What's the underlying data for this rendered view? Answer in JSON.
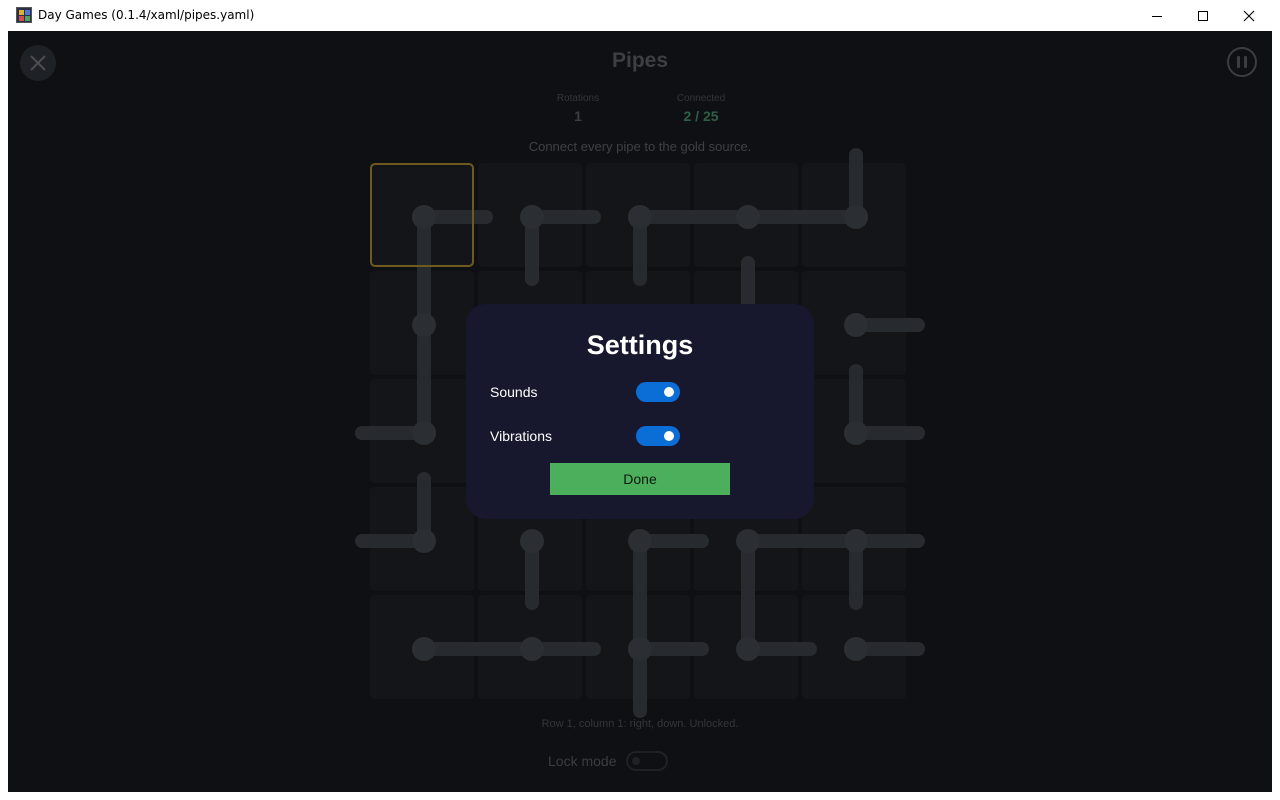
{
  "window": {
    "title": "Day Games (0.1.4/xaml/pipes.yaml)",
    "minimize_icon": "minimize-icon",
    "maximize_icon": "maximize-icon",
    "close_icon": "close-icon"
  },
  "game": {
    "title": "Pipes",
    "stats": [
      {
        "label": "Rotations",
        "value": "1"
      },
      {
        "label": "Connected",
        "value": "2 / 25"
      }
    ],
    "instructions": "Connect every pipe to the gold source.",
    "status_line": "Row 1, column 1: right, down. Unlocked.",
    "lock_mode_label": "Lock mode",
    "lock_mode_on": false,
    "selected_cell": {
      "row": 1,
      "col": 1
    },
    "grid": {
      "rows": 5,
      "cols": 5,
      "cells": [
        [
          "RD",
          "RD",
          "RD",
          "LR",
          "LU"
        ],
        [
          "UD",
          "E",
          "E",
          "U",
          "R"
        ],
        [
          "LU",
          "E",
          "E",
          "E",
          "UR"
        ],
        [
          "LU",
          "D",
          "RD",
          "RD",
          "LRD"
        ],
        [
          "R",
          "LR",
          "URD",
          "UR",
          "R"
        ]
      ]
    }
  },
  "settings_dialog": {
    "title": "Settings",
    "sounds_label": "Sounds",
    "sounds_on": true,
    "vibrations_label": "Vibrations",
    "vibrations_on": true,
    "done_label": "Done"
  },
  "colors": {
    "background": "#0e1013",
    "pipe": "#272b2f",
    "source_highlight": "#6e5a1c",
    "connected_text": "#2f5e46",
    "dialog_bg": "#17172e",
    "toggle_on": "#0a6ed6",
    "done_button": "#4caf5c"
  }
}
